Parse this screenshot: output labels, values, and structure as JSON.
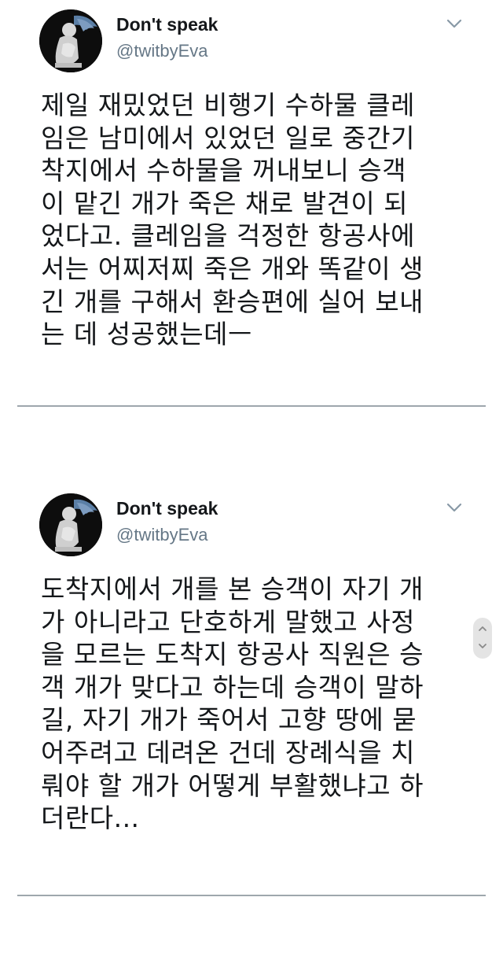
{
  "tweets": [
    {
      "author": {
        "display_name": "Don't speak",
        "handle": "@twitbyEva"
      },
      "menu_icon": "chevron-down-icon",
      "text_lines": [
        "제일 재밌었던 비행기 수하물 클레",
        "임은 남미에서 있었던 일로 중간기",
        "착지에서 수하물을 꺼내보니 승객",
        "이 맡긴 개가 죽은 채로 발견이 되",
        "었다고. 클레임을 걱정한 항공사에",
        "서는 어찌저찌 죽은 개와 똑같이 생",
        "긴 개를 구해서 환승편에 실어 보내",
        "는 데 성공했는데ㅡ"
      ]
    },
    {
      "author": {
        "display_name": "Don't speak",
        "handle": "@twitbyEva"
      },
      "menu_icon": "chevron-down-icon",
      "text_lines": [
        "도착지에서 개를 본 승객이 자기 개",
        "가 아니라고 단호하게 말했고 사정",
        "을 모르는 도착지 항공사 직원은 승",
        "객 개가 맞다고 하는데 승객이 말하",
        "길, 자기 개가 죽어서 고향 땅에 묻",
        "어주려고 데려온 건데 장례식을 치",
        "뤄야 할 개가 어떻게 부활했냐고 하",
        "더란다..."
      ]
    }
  ],
  "colors": {
    "text": "#14171a",
    "handle": "#657786",
    "divider": "#9ea7ad",
    "avatar_bg": "#111111"
  }
}
